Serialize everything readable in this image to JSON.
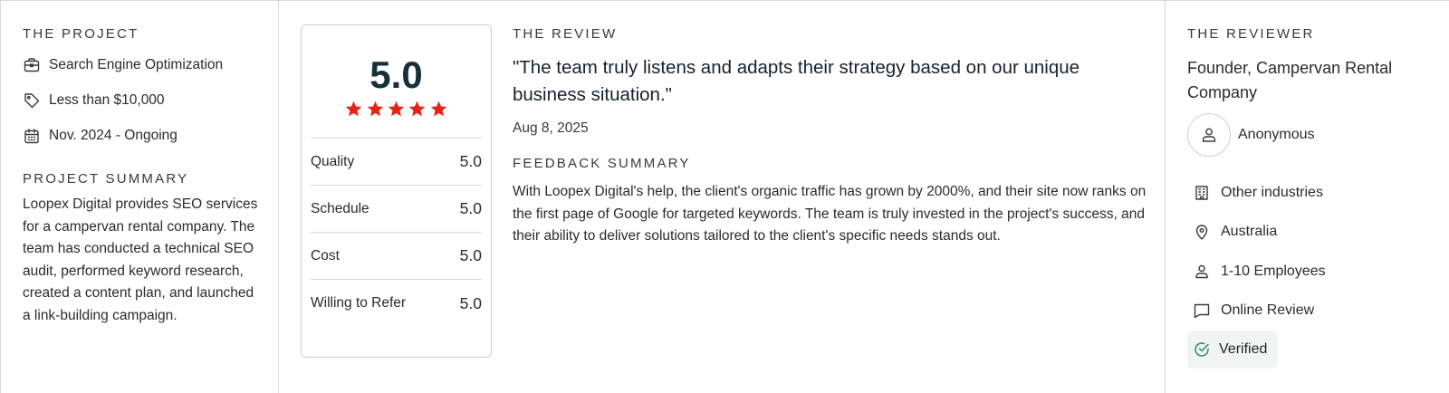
{
  "project": {
    "heading": "THE PROJECT",
    "service": "Search Engine Optimization",
    "budget": "Less than $10,000",
    "dates": "Nov. 2024 - Ongoing",
    "summary_heading": "PROJECT SUMMARY",
    "summary": "Loopex Digital provides SEO services for a campervan rental company. The team has conducted a technical SEO audit, performed keyword research, created a content plan, and launched a link-building campaign."
  },
  "rating": {
    "overall": "5.0",
    "stars": 5,
    "rows": [
      {
        "label": "Quality",
        "value": "5.0"
      },
      {
        "label": "Schedule",
        "value": "5.0"
      },
      {
        "label": "Cost",
        "value": "5.0"
      },
      {
        "label": "Willing to Refer",
        "value": "5.0"
      }
    ],
    "star_color": "#e62415"
  },
  "review": {
    "heading": "THE REVIEW",
    "quote": "\"The team truly listens and adapts their strategy based on our unique business situation.\"",
    "date": "Aug 8, 2025",
    "feedback_heading": "FEEDBACK SUMMARY",
    "feedback": "With Loopex Digital's help, the client's organic traffic has grown by 2000%, and their site now ranks on the first page of Google for targeted keywords. The team is truly invested in the project's success, and their ability to deliver solutions tailored to the client's specific needs stands out."
  },
  "reviewer": {
    "heading": "THE REVIEWER",
    "title": "Founder, Campervan Rental Company",
    "name": "Anonymous",
    "industry": "Other industries",
    "location": "Australia",
    "company_size": "1-10 Employees",
    "review_type": "Online Review",
    "verified": "Verified",
    "verified_color": "#1f8a4c"
  },
  "icons": {
    "service": "briefcase-icon",
    "budget": "price-tag-icon",
    "dates": "calendar-icon",
    "avatar": "user-icon",
    "industry": "building-icon",
    "location": "location-pin-icon",
    "company_size": "person-icon",
    "review_type": "chat-bubble-icon",
    "verified": "check-circle-icon"
  }
}
